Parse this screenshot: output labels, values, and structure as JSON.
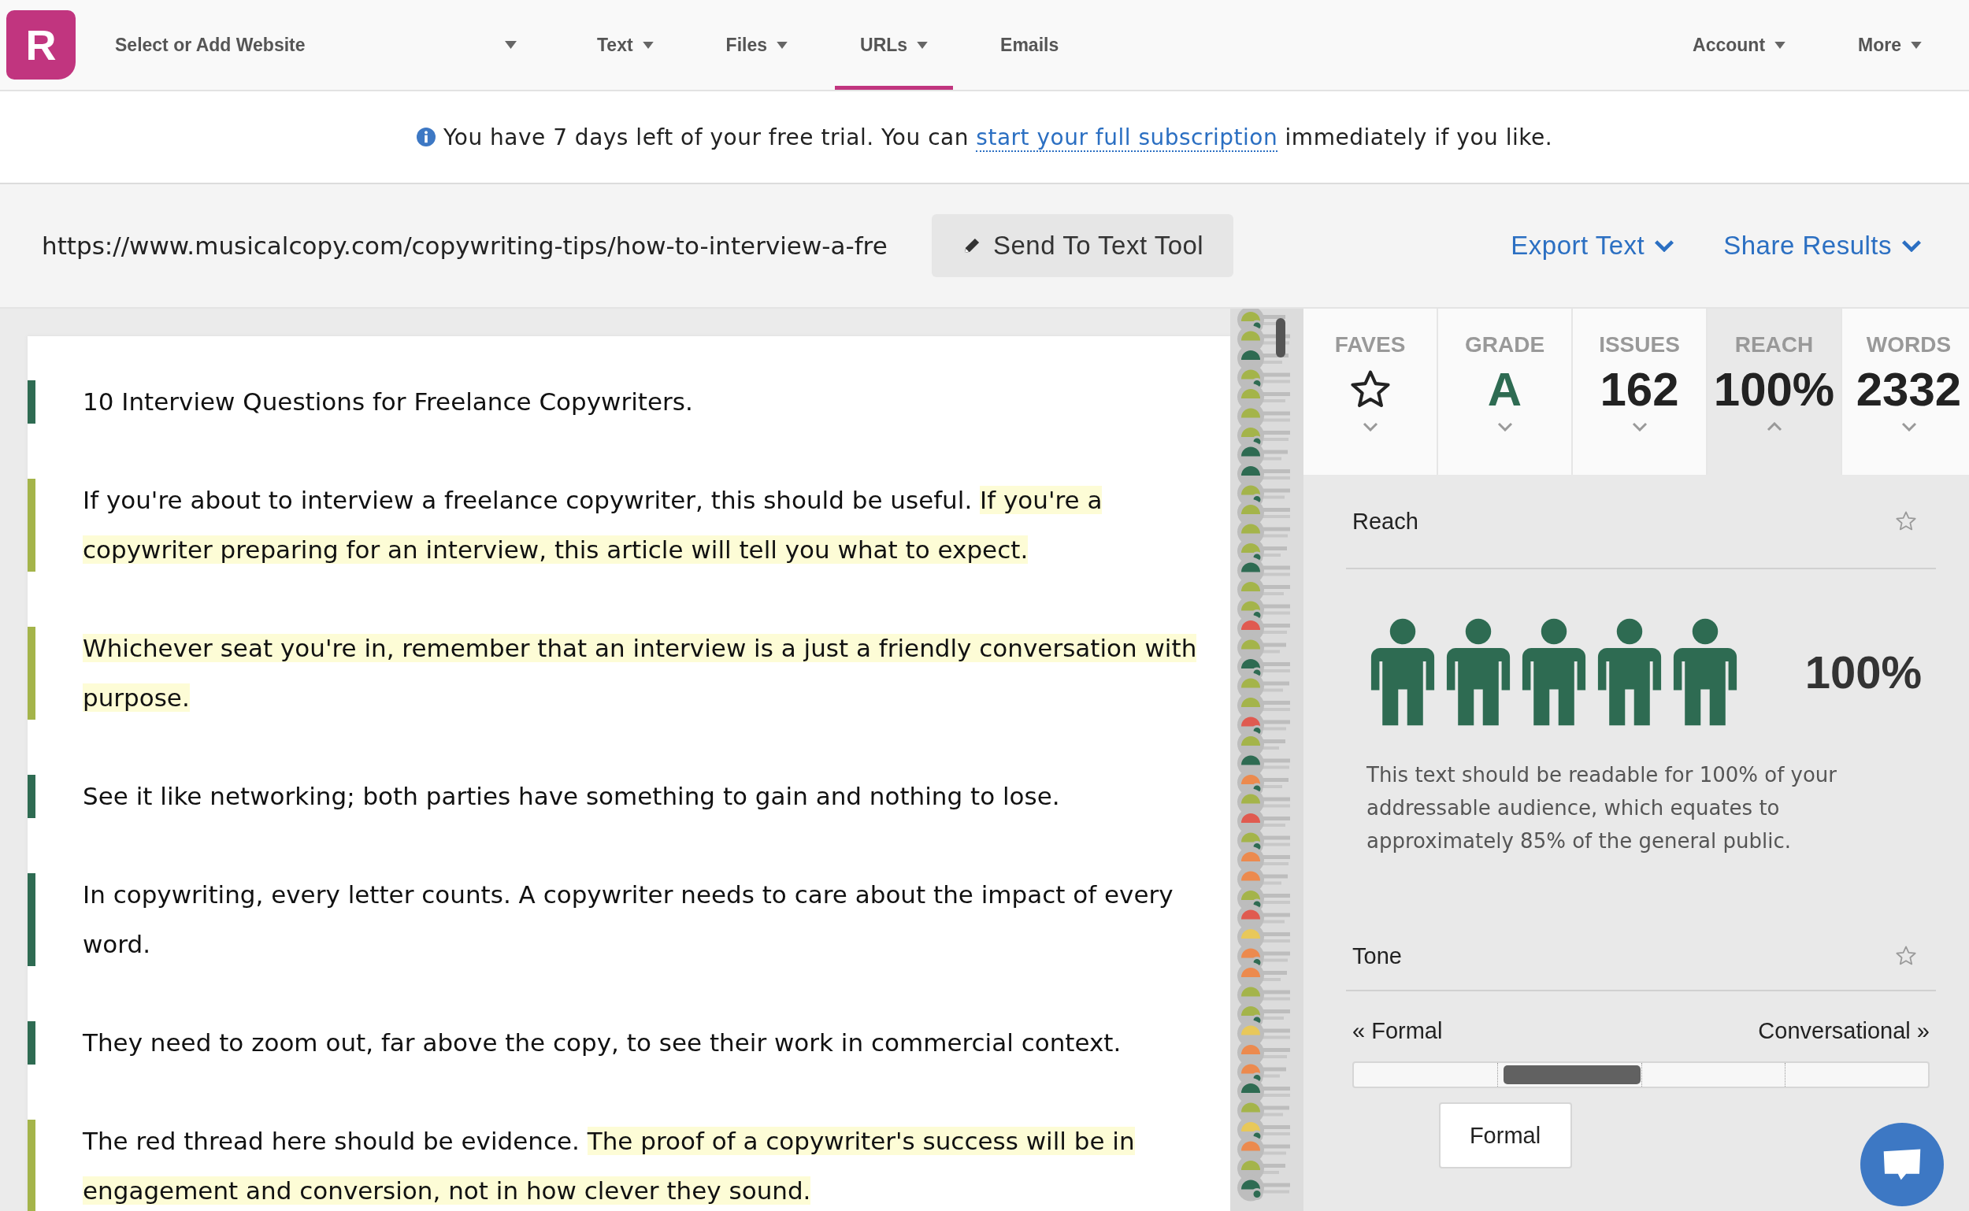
{
  "nav": {
    "logo": "R",
    "site_select": "Select or Add Website",
    "menus": [
      {
        "label": "Text",
        "dropdown": true,
        "selected": false
      },
      {
        "label": "Files",
        "dropdown": true,
        "selected": false
      },
      {
        "label": "URLs",
        "dropdown": true,
        "selected": true
      },
      {
        "label": "Emails",
        "dropdown": false,
        "selected": false
      }
    ],
    "right_menus": [
      {
        "label": "Account",
        "dropdown": true
      },
      {
        "label": "More",
        "dropdown": true
      }
    ]
  },
  "trial_notice": {
    "before": "You have 7 days left of your free trial. You can",
    "link": "start your full subscription",
    "after": "immediately if you like."
  },
  "url_bar": {
    "url": "https://www.musicalcopy.com/copywriting-tips/how-to-interview-a-fre",
    "send_button": "Send To Text Tool",
    "actions": [
      "Export Text",
      "Share Results"
    ]
  },
  "document": {
    "paragraphs": [
      {
        "color": "#2e6b52",
        "segments": [
          {
            "text": "10 Interview Questions for Freelance Copywriters.",
            "highlight": false
          }
        ]
      },
      {
        "color": "#a4b44a",
        "segments": [
          {
            "text": "If you're about to interview a freelance copywriter, this should be useful.",
            "highlight": false
          },
          {
            "text": "If you're a copywriter preparing for an interview, this article will tell you what to expect.",
            "highlight": true
          }
        ]
      },
      {
        "color": "#a4b44a",
        "segments": [
          {
            "text": "Whichever seat you're in, remember that an interview is a just a friendly conversation with purpose.",
            "highlight": true
          }
        ]
      },
      {
        "color": "#2e6b52",
        "segments": [
          {
            "text": "See it like networking; both parties have something to gain and nothing to lose.",
            "highlight": false
          }
        ]
      },
      {
        "color": "#2e6b52",
        "segments": [
          {
            "text": "In copywriting, every letter counts. A copywriter needs to care about the impact of every word.",
            "highlight": false
          }
        ]
      },
      {
        "color": "#2e6b52",
        "segments": [
          {
            "text": "They need to zoom out, far above the copy, to see their work in commercial context.",
            "highlight": false
          }
        ]
      },
      {
        "color": "#a4b44a",
        "segments": [
          {
            "text": "The red thread here should be evidence.",
            "highlight": false
          },
          {
            "text": "The proof of a copywriter's success will be in engagement and conversion, not in how clever they sound.",
            "highlight": true
          }
        ]
      }
    ]
  },
  "metrics": [
    {
      "label": "FAVES",
      "kind": "favorite",
      "selected": false
    },
    {
      "label": "GRADE",
      "kind": "grade",
      "value": "A",
      "selected": false
    },
    {
      "label": "ISSUES",
      "kind": "count",
      "value": "162",
      "selected": false
    },
    {
      "label": "REACH",
      "kind": "count",
      "value": "100%",
      "selected": true
    },
    {
      "label": "WORDS",
      "kind": "count",
      "value": "2332",
      "selected": false
    }
  ],
  "reach": {
    "title": "Reach",
    "value": "100%",
    "description": "This text should be readable for 100% of your addressable audience, which equates to approximately 85% of the general public."
  },
  "tone": {
    "title": "Tone",
    "left_label": "« Formal",
    "right_label": "Conversational »",
    "level": 0.38,
    "tooltip": "Formal"
  }
}
